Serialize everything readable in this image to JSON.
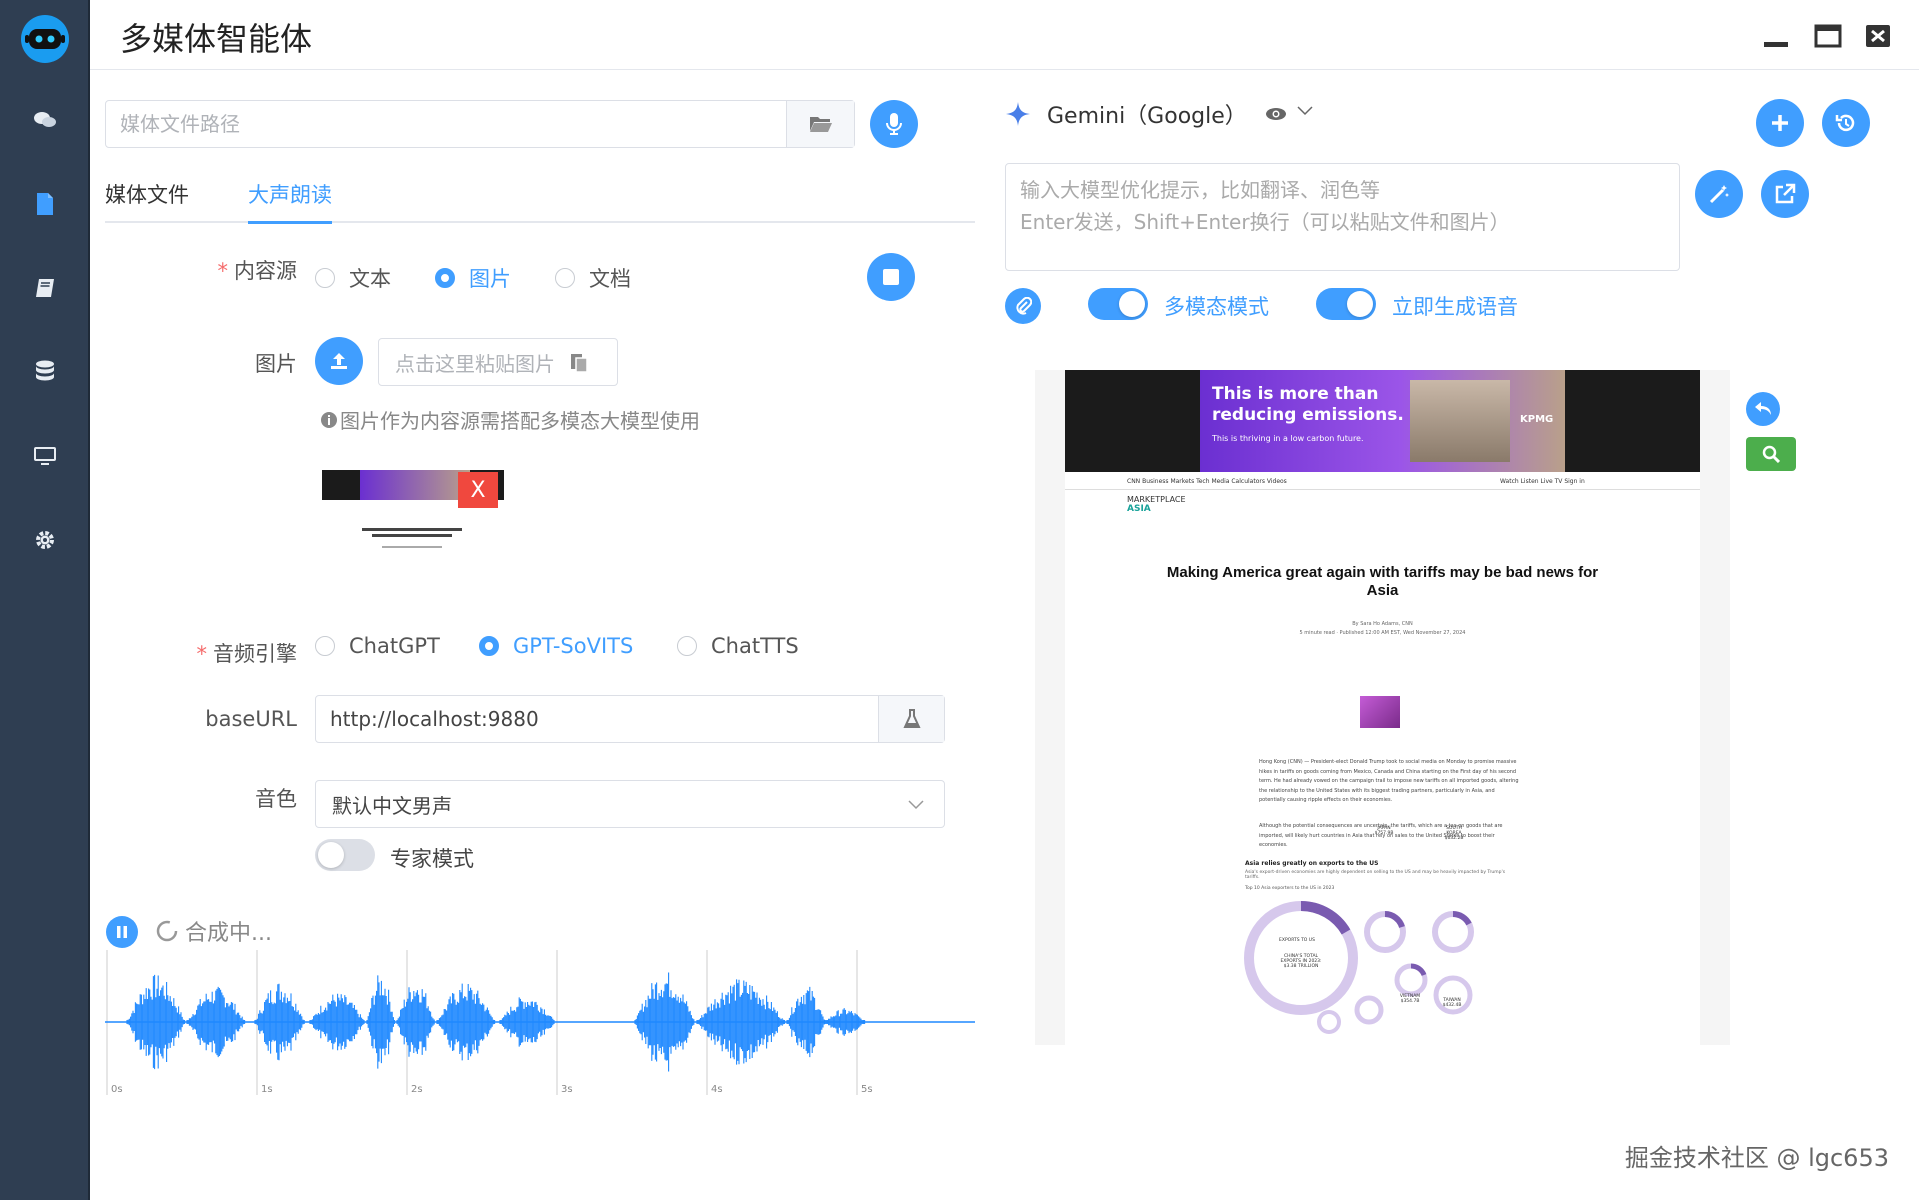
{
  "app": {
    "title": "多媒体智能体"
  },
  "left": {
    "path_placeholder": "媒体文件路径",
    "tabs": [
      {
        "label": "媒体文件"
      },
      {
        "label": "大声朗读"
      }
    ],
    "content_source": {
      "label": "内容源",
      "options": [
        {
          "label": "文本"
        },
        {
          "label": "图片"
        },
        {
          "label": "文档"
        }
      ],
      "selected": "图片"
    },
    "image": {
      "label": "图片",
      "paste_label": "点击这里粘贴图片",
      "hint": "图片作为内容源需搭配多模态大模型使用",
      "remove_label": "X"
    },
    "audio_engine": {
      "label": "音频引擎",
      "options": [
        {
          "label": "ChatGPT"
        },
        {
          "label": "GPT-SoVITS"
        },
        {
          "label": "ChatTTS"
        }
      ],
      "selected": "GPT-SoVITS"
    },
    "base_url": {
      "label": "baseURL",
      "value": "http://localhost:9880"
    },
    "voice": {
      "label": "音色",
      "value": "默认中文男声"
    },
    "expert_mode": {
      "label": "专家模式",
      "enabled": false
    },
    "player": {
      "status": "合成中...",
      "time_ticks": [
        "0s",
        "1s",
        "2s",
        "3s",
        "4s",
        "5s"
      ]
    }
  },
  "right": {
    "model": {
      "name": "Gemini（Google）"
    },
    "prompt_placeholder": "输入大模型优化提示，比如翻译、润色等\nEnter发送，Shift+Enter换行（可以粘贴文件和图片）",
    "multimodal": {
      "label": "多模态模式",
      "enabled": true
    },
    "instant_voice": {
      "label": "立即生成语音",
      "enabled": true
    },
    "preview": {
      "ad_line1": "This is more than",
      "ad_line2": "reducing emissions.",
      "ad_sub": "This is thriving in a low carbon future.",
      "ad_brand": "KPMG",
      "nav": "CNN Business   Markets   Tech   Media   Calculators   Videos",
      "nav_right": "Watch   Listen   Live TV   Sign in",
      "section_1": "MARKETPLACE",
      "section_2": "ASIA",
      "headline": "Making America great again with tariffs may be bad news for Asia",
      "byline": "By Sara Ho Adams, CNN",
      "timestamp": "5 minute read · Published 12:00 AM EST, Wed November 27, 2024",
      "para1": "Hong Kong (CNN) — President-elect Donald Trump took to social media on Monday to promise massive hikes in tariffs on goods coming from Mexico, Canada and China starting on the First day of his second term. He had already vowed on the campaign trail to impose new tariffs on all imported goods, altering the relationship to the United States with its biggest trading partners, particularly in Asia, and potentially causing ripple effects on their economies.",
      "para2": "Although the potential consequences are uncertain, the tariffs, which are a tax on goods that are imported, will likely hurt countries in Asia that rely on sales to the United States to boost their economies.",
      "chart_title": "Asia relies greatly on exports to the US",
      "chart_sub": "Asia's export-driven economies are highly dependent on selling to the US and may be heavily impacted by Trump's tariffs.",
      "chart_caption": "Top 10 Asia exporters to the US in 2023",
      "china_label": "CHINA'S TOTAL EXPORTS IN 2023: $3.38 TRILLION",
      "exports_label": "EXPORTS TO US",
      "japan_label": "JAPAN $757.9B",
      "korea_label": "SOUTH KOREA $632.2B",
      "vietnam_label": "VIETNAM $354.7B",
      "taiwan_label": "TAIWAN $432.4B"
    }
  },
  "watermark": "掘金技术社区 @ lgc653",
  "colors": {
    "accent": "#409eff",
    "sidebar": "#2f3e52",
    "waveform": "#1e88ff",
    "success": "#4cae4c",
    "danger": "#f0483e"
  }
}
